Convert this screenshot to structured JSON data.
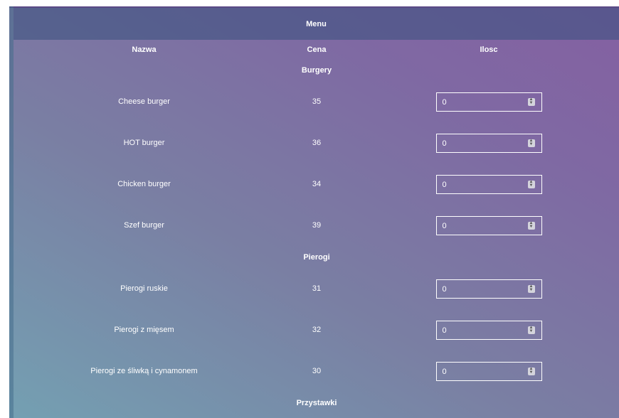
{
  "menu": {
    "title": "Menu",
    "headers": {
      "name": "Nazwa",
      "price": "Cena",
      "qty": "Ilosc"
    },
    "categories": [
      {
        "name": "Burgery",
        "items": [
          {
            "name": "Cheese burger",
            "price": "35",
            "qty": "0"
          },
          {
            "name": "HOT burger",
            "price": "36",
            "qty": "0"
          },
          {
            "name": "Chicken burger",
            "price": "34",
            "qty": "0"
          },
          {
            "name": "Szef burger",
            "price": "39",
            "qty": "0"
          }
        ]
      },
      {
        "name": "Pierogi",
        "items": [
          {
            "name": "Pierogi ruskie",
            "price": "31",
            "qty": "0"
          },
          {
            "name": "Pierogi z mięsem",
            "price": "32",
            "qty": "0"
          },
          {
            "name": "Pierogi ze śliwką i cynamonem",
            "price": "30",
            "qty": "0"
          }
        ]
      },
      {
        "name": "Przystawki",
        "items": []
      }
    ]
  },
  "icons": {
    "spinner": "spin-up-down-icon"
  }
}
